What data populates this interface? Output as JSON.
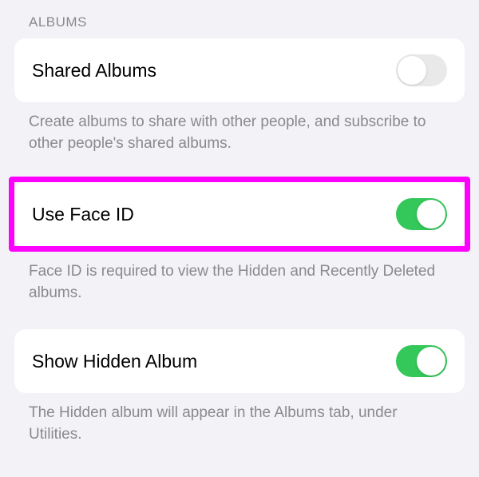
{
  "section_header": "ALBUMS",
  "settings": {
    "shared_albums": {
      "label": "Shared Albums",
      "description": "Create albums to share with other people, and subscribe to other people's shared albums.",
      "enabled": false
    },
    "use_face_id": {
      "label": "Use Face ID",
      "description": "Face ID is required to view the Hidden and Recently Deleted albums.",
      "enabled": true
    },
    "show_hidden_album": {
      "label": "Show Hidden Album",
      "description": "The Hidden album will appear in the Albums tab, under Utilities.",
      "enabled": true
    }
  }
}
